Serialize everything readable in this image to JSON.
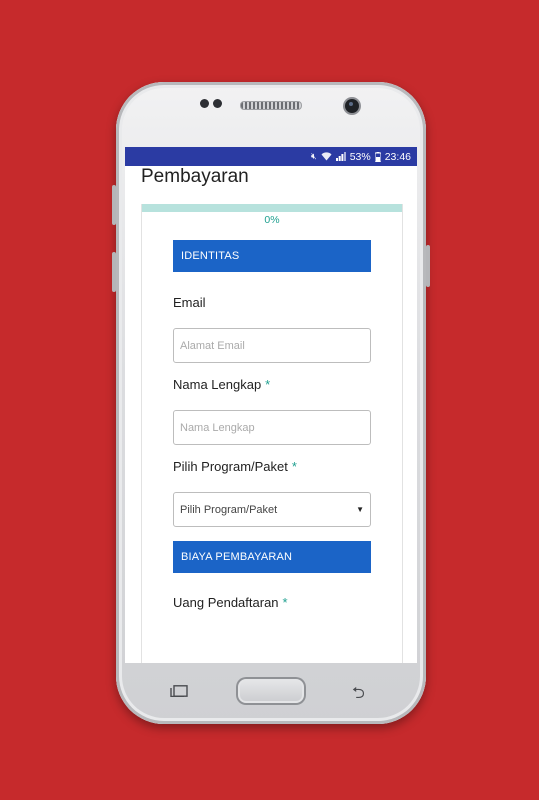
{
  "status_bar": {
    "battery": "53%",
    "time": "23:46",
    "icons": [
      "mute-icon",
      "wifi-icon",
      "signal-icon",
      "battery-icon"
    ]
  },
  "app": {
    "title": "Pembayaran"
  },
  "progress": {
    "text": "0%",
    "value": 0
  },
  "form": {
    "identitas_header": "IDENTITAS",
    "email": {
      "label": "Email",
      "placeholder": "Alamat Email"
    },
    "nama": {
      "label": "Nama Lengkap",
      "required": "*",
      "placeholder": "Nama Lengkap"
    },
    "program": {
      "label": "Pilih Program/Paket",
      "required": "*",
      "selected": "Pilih Program/Paket"
    },
    "biaya_header": "BIAYA PEMBAYARAN",
    "uang_pendaftaran": {
      "label": "Uang Pendaftaran",
      "required": "*"
    }
  },
  "colors": {
    "background": "#c62a2c",
    "status_bar": "#2b3ba3",
    "section_header": "#1b64c7",
    "accent": "#20a090",
    "progress_track": "#b7e2dd"
  }
}
